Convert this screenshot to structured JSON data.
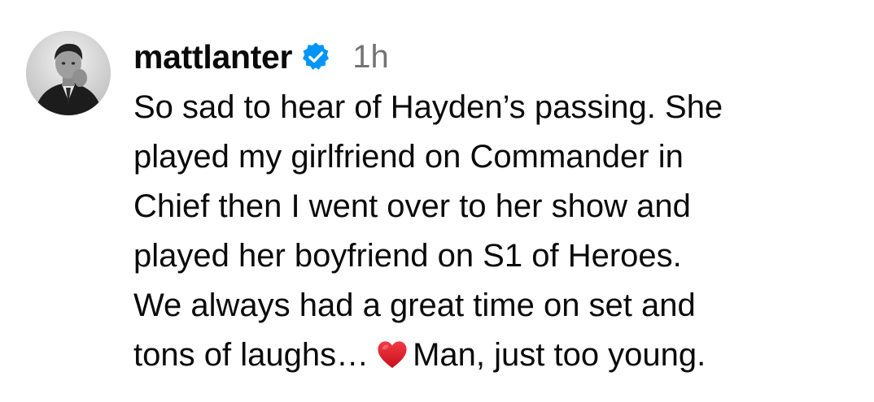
{
  "comment": {
    "avatar_icon": "profile-photo",
    "username": "mattlanter",
    "verified_icon": "verified-badge-icon",
    "verified_color": "#0095f6",
    "timestamp": "1h",
    "text_lines": [
      "So sad to hear of Hayden’s passing. She",
      "played my girlfriend on Commander in",
      "Chief then I went over to her show and",
      "played her boyfriend on S1 of Heroes.",
      "We always had a great time on set and"
    ],
    "last_line_before_emoji": "tons of laughs…",
    "emoji_icon": "red-heart-icon",
    "emoji_color": "#e0202e",
    "last_line_after_emoji": "Man, just too young."
  }
}
